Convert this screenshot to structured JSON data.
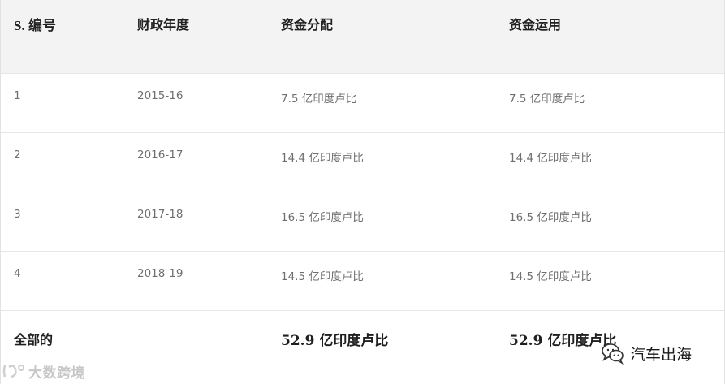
{
  "table": {
    "headers": [
      "S. 编号",
      "财政年度",
      "资金分配",
      "资金运用"
    ],
    "rows": [
      [
        "1",
        "2015-16",
        "7.5 亿印度卢比",
        "7.5 亿印度卢比"
      ],
      [
        "2",
        "2016-17",
        "14.4 亿印度卢比",
        "14.4 亿印度卢比"
      ],
      [
        "3",
        "2017-18",
        "16.5 亿印度卢比",
        "16.5 亿印度卢比"
      ],
      [
        "4",
        "2018-19",
        "14.5 亿印度卢比",
        "14.5 亿印度卢比"
      ]
    ],
    "total": {
      "label": "全部的",
      "allocation": "52.9 亿印度卢比",
      "utilization": "52.9 亿印度卢比"
    }
  },
  "watermarks": {
    "left_text": "大数跨境",
    "right_text": "汽车出海"
  }
}
